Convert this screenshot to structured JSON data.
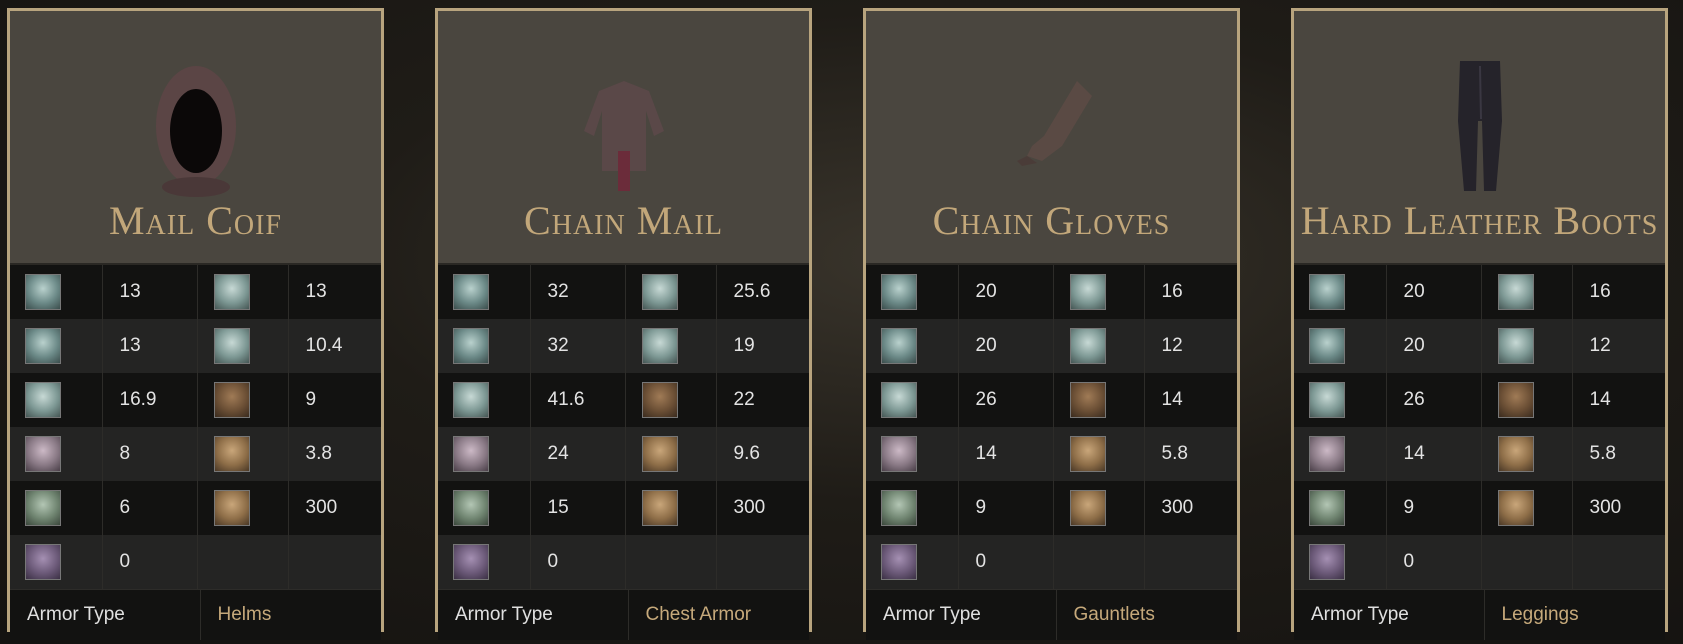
{
  "colors": {
    "accent_gold": "#c2a77a",
    "border": "#b8a47e",
    "header_bg": "#4a463f"
  },
  "footer_label": "Armor Type",
  "icons": {
    "r1a": "physical-armor-icon",
    "r1b": "pierce-icon",
    "r2a": "blunt-icon",
    "r2b": "magic-icon",
    "r3a": "slash-icon",
    "r3b": "fire-icon",
    "r4a": "blood-icon",
    "r4b": "weight-icon",
    "r5a": "poison-skull-icon",
    "r5b": "durability-hammer-icon",
    "r6a": "arcane-icon"
  },
  "cards": [
    {
      "name": "Mail Coif",
      "image": "mail-coif-icon",
      "stats": [
        [
          "13",
          "13"
        ],
        [
          "13",
          "10.4"
        ],
        [
          "16.9",
          "9"
        ],
        [
          "8",
          "3.8"
        ],
        [
          "6",
          "300"
        ],
        [
          "0",
          ""
        ]
      ],
      "armor_type": "Helms"
    },
    {
      "name": "Chain Mail",
      "image": "chain-mail-icon",
      "stats": [
        [
          "32",
          "25.6"
        ],
        [
          "32",
          "19"
        ],
        [
          "41.6",
          "22"
        ],
        [
          "24",
          "9.6"
        ],
        [
          "15",
          "300"
        ],
        [
          "0",
          ""
        ]
      ],
      "armor_type": "Chest Armor"
    },
    {
      "name": "Chain Gloves",
      "image": "chain-gloves-icon",
      "stats": [
        [
          "20",
          "16"
        ],
        [
          "20",
          "12"
        ],
        [
          "26",
          "14"
        ],
        [
          "14",
          "5.8"
        ],
        [
          "9",
          "300"
        ],
        [
          "0",
          ""
        ]
      ],
      "armor_type": "Gauntlets"
    },
    {
      "name": "Hard Leather Boots",
      "image": "leather-boots-icon",
      "stats": [
        [
          "20",
          "16"
        ],
        [
          "20",
          "12"
        ],
        [
          "26",
          "14"
        ],
        [
          "14",
          "5.8"
        ],
        [
          "9",
          "300"
        ],
        [
          "0",
          ""
        ]
      ],
      "armor_type": "Leggings"
    }
  ]
}
